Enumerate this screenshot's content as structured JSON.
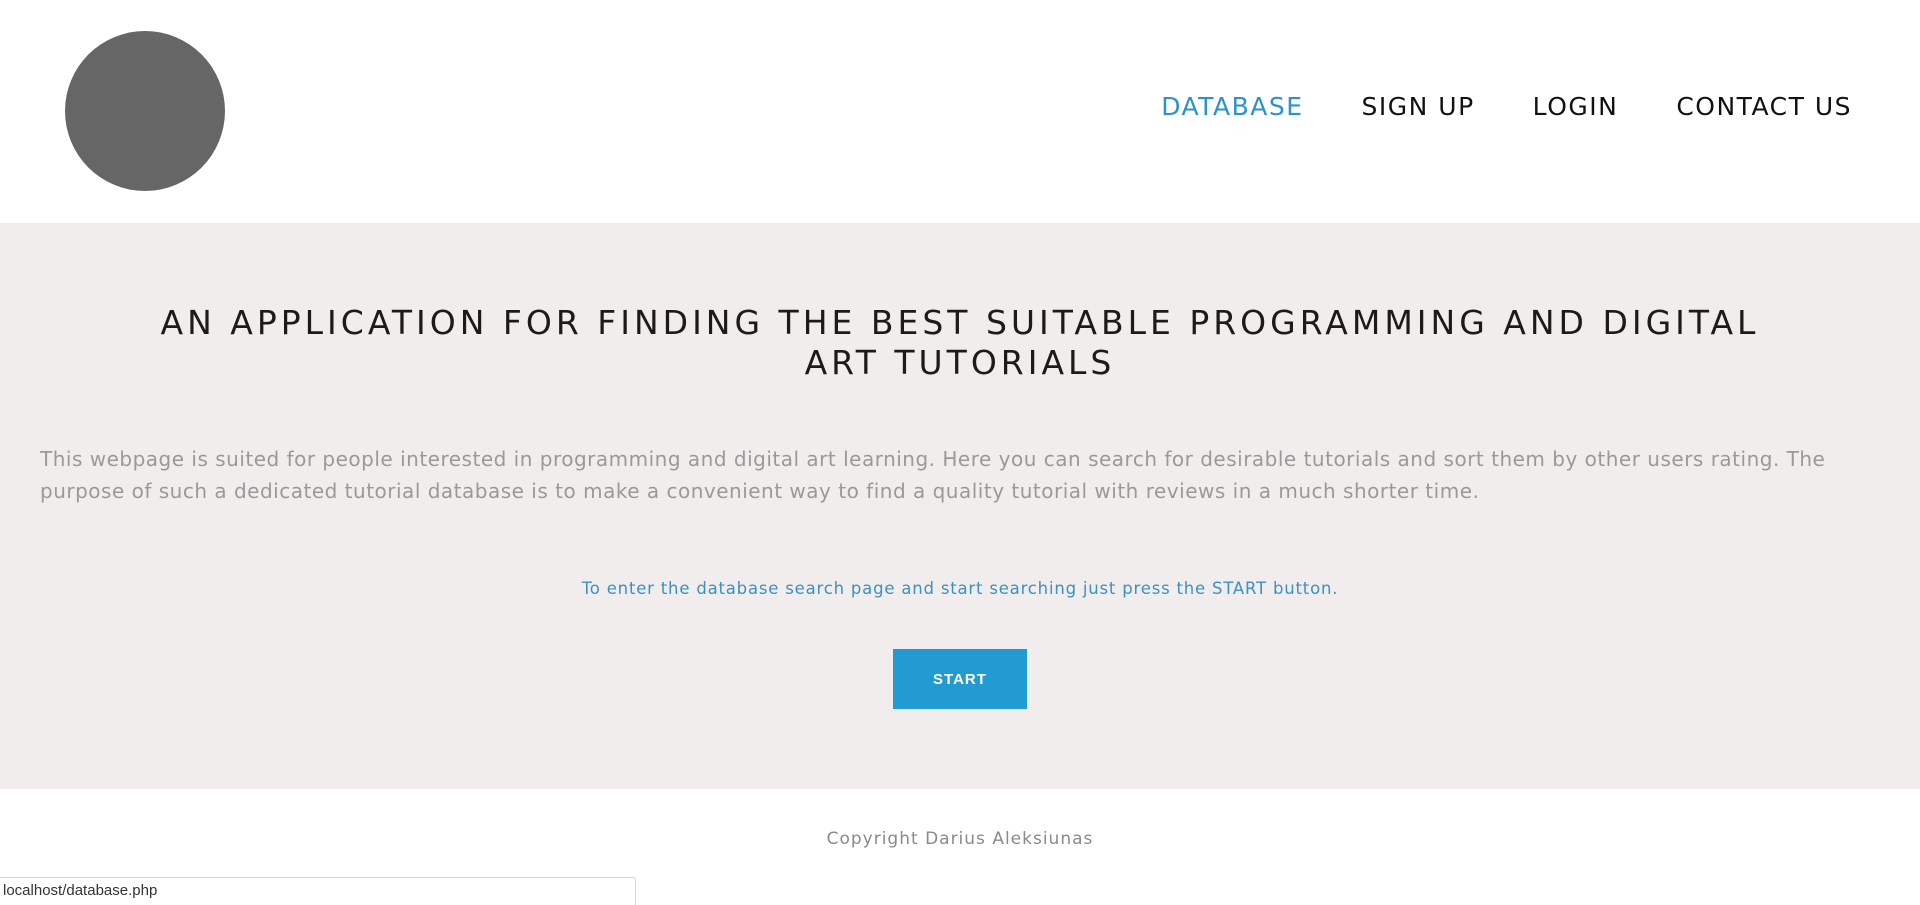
{
  "header": {
    "logo": "logo-circle",
    "nav": [
      {
        "label": "DATABASE",
        "active": true
      },
      {
        "label": "SIGN UP",
        "active": false
      },
      {
        "label": "LOGIN",
        "active": false
      },
      {
        "label": "CONTACT US",
        "active": false
      }
    ]
  },
  "hero": {
    "title": "AN APPLICATION FOR FINDING THE BEST SUITABLE PROGRAMMING AND DIGITAL ART TUTORIALS",
    "intro": "This webpage is suited for people interested in programming and digital art learning. Here you can search for desirable tutorials and sort them by other users rating. The purpose of such a dedicated tutorial database is to make a convenient way to find a quality tutorial with reviews in a much shorter time.",
    "hint": "To enter the database search page and start searching just press the START button.",
    "start_label": "START"
  },
  "footer": {
    "copyright": "Copyright Darius Aleksiunas"
  },
  "statusbar": {
    "url": "localhost/database.php"
  },
  "colors": {
    "accent": "#229bd2",
    "active_nav": "#2a93c9",
    "hero_bg": "#f2eded",
    "logo": "#666666"
  }
}
